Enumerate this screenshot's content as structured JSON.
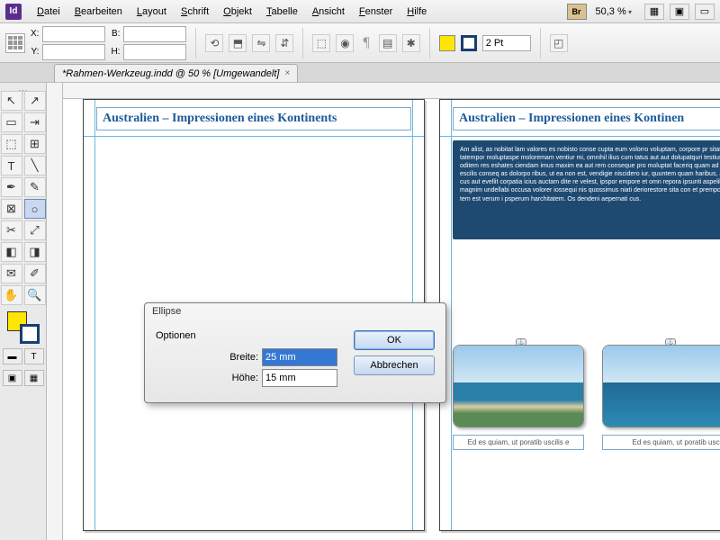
{
  "menu": {
    "items": [
      "Datei",
      "Bearbeiten",
      "Layout",
      "Schrift",
      "Objekt",
      "Tabelle",
      "Ansicht",
      "Fenster",
      "Hilfe"
    ],
    "br_label": "Br",
    "zoom": "50,3 %"
  },
  "control": {
    "x_label": "X:",
    "y_label": "Y:",
    "w_label": "B:",
    "h_label": "H:",
    "stroke_weight": "2 Pt",
    "fill_color": "#ffe600",
    "stroke_color": "#1a3e6e"
  },
  "tab": {
    "title": "*Rahmen-Werkzeug.indd @ 50 % [Umgewandelt]",
    "close": "×"
  },
  "document": {
    "title_left": "Australien – Impressionen eines Kontinents",
    "title_right": "Australien – Impressionen eines Kontinen",
    "body_text": "Am alist, as nobitat lam valores es nobisto conse cupta eum volorro voluptam, corpore pr sitat. Ellabor accus siminci tatempor moluptaspe moloremam ventiur mi, omnihil ilius cum tatus aut aut dolupatquri testiusam euq eshatem et oditem res eshates ciendam imus maxim ea aut rem conseque pro moluptat faceriq quam ad eo pe naturia comnis escilis conseq as dolorpo ribus, ut ea non est, vendigie niscidero iur, quuntem quam haribus, aut reh nis equaque rem, cus aut evellit corpatia icius auctam dite re velest, ipspor empore et omn repora ipsunti aspelibusam non rerum fugit magnim undellabi occusa volorer iossequi nis quossimus niati deriorestore sita con et prempost, arundi acera nes erit, tem est verum i psperum harchitatem. Os dendeni aepernati cus.",
    "caption": "Ed es quiam, ut poratib uscilis e"
  },
  "dialog": {
    "title": "Ellipse",
    "options_label": "Optionen",
    "width_label": "Breite:",
    "height_label": "Höhe:",
    "width_value": "25 mm",
    "height_value": "15 mm",
    "ok": "OK",
    "cancel": "Abbrechen"
  }
}
